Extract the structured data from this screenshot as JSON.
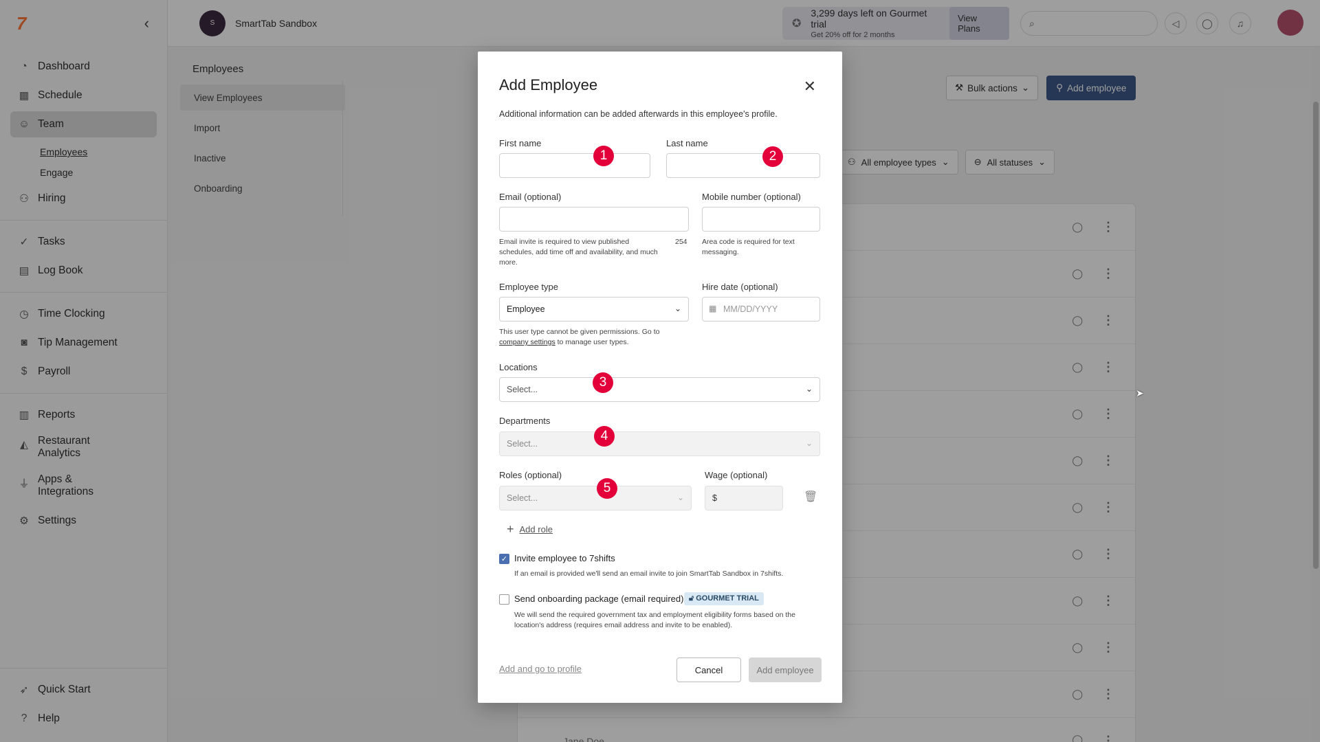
{
  "app": {
    "logo": "7",
    "org_avatar_text": "S",
    "org_name": "SmartTab Sandbox"
  },
  "trial": {
    "title": "3,299 days left on Gourmet trial",
    "subtitle": "Get 20% off for 2 months",
    "cta": "View Plans"
  },
  "sidebar": {
    "items": [
      {
        "label": "Dashboard",
        "icon": "dashboard-icon"
      },
      {
        "label": "Schedule",
        "icon": "calendar-icon"
      },
      {
        "label": "Team",
        "icon": "team-icon",
        "active": true
      },
      {
        "label": "Hiring",
        "icon": "hiring-icon"
      },
      {
        "label": "Tasks",
        "icon": "check-icon"
      },
      {
        "label": "Log Book",
        "icon": "logbook-icon"
      },
      {
        "label": "Time Clocking",
        "icon": "clock-icon"
      },
      {
        "label": "Tip Management",
        "icon": "tip-icon"
      },
      {
        "label": "Payroll",
        "icon": "payroll-icon"
      },
      {
        "label": "Reports",
        "icon": "reports-icon"
      },
      {
        "label": "Restaurant Analytics",
        "icon": "analytics-icon"
      },
      {
        "label": "Apps & Integrations",
        "icon": "plug-icon"
      },
      {
        "label": "Settings",
        "icon": "gear-icon"
      },
      {
        "label": "Quick Start",
        "icon": "rocket-icon"
      },
      {
        "label": "Help",
        "icon": "help-icon"
      }
    ],
    "team_sub": [
      "Employees",
      "Engage"
    ]
  },
  "subnav": {
    "title": "Employees",
    "items": [
      "View Employees",
      "Import",
      "Inactive",
      "Onboarding"
    ]
  },
  "main": {
    "bulk_actions": "Bulk actions",
    "add_employee": "Add employee",
    "filters": [
      "All employee types",
      "All statuses"
    ],
    "bottom_row_name": "Jane Doe"
  },
  "modal": {
    "title": "Add Employee",
    "description": "Additional information can be added afterwards in this employee's profile.",
    "first_name_label": "First name",
    "last_name_label": "Last name",
    "email_label": "Email (optional)",
    "email_hint": "Email invite is required to view published schedules, add time off and availability, and much more.",
    "email_counter": "254",
    "mobile_label": "Mobile number (optional)",
    "mobile_hint": "Area code is required for text messaging.",
    "employee_type_label": "Employee type",
    "employee_type_value": "Employee",
    "employee_type_hint_1": "This user type cannot be given permissions. Go to",
    "employee_type_hint_link": "company settings",
    "employee_type_hint_2": "to manage user types.",
    "hire_date_label": "Hire date (optional)",
    "hire_date_placeholder": "MM/DD/YYYY",
    "locations_label": "Locations",
    "locations_placeholder": "Select...",
    "departments_label": "Departments",
    "departments_placeholder": "Select...",
    "roles_label": "Roles (optional)",
    "roles_placeholder": "Select...",
    "wage_label": "Wage (optional)",
    "wage_prefix": "$",
    "add_role": "Add role",
    "invite_label": "Invite employee to 7shifts",
    "invite_sub": "If an email is provided we'll send an email invite to join SmartTab Sandbox in 7shifts.",
    "onboarding_label": "Send onboarding package (email required)",
    "onboarding_badge": "GOURMET TRIAL",
    "onboarding_sub": "We will send the required government tax and employment eligibility forms based on the location's address (requires email address and invite to be enabled).",
    "add_and_go": "Add and go to profile",
    "cancel": "Cancel",
    "submit": "Add employee"
  },
  "annotations": [
    "1",
    "2",
    "3",
    "4",
    "5"
  ]
}
